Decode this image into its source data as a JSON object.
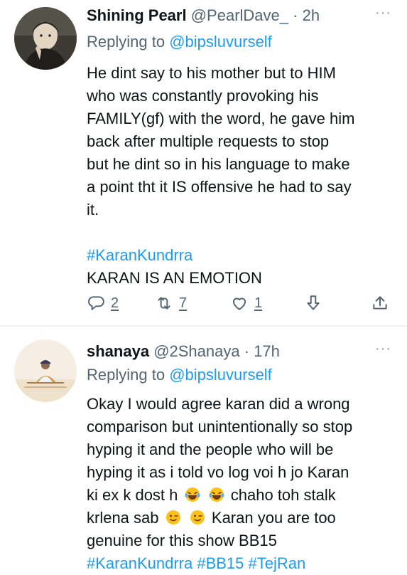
{
  "tweets": [
    {
      "name": "Shining Pearl",
      "handle": "@PearlDave_",
      "dot": "·",
      "time": "2h",
      "more": "···",
      "replying_prefix": "Replying to ",
      "replying_to": "@bipsluvurself",
      "body_lines": [
        "He dint say to his mother but to HIM",
        "who was constantly provoking his",
        "FAMILY(gf) with the word, he gave him",
        "back after multiple requests to stop",
        "but he dint so in his language to make",
        "a point tht it IS offensive he had to say",
        "it."
      ],
      "hashtag": "#KaranKundrra",
      "last_line": "KARAN IS AN EMOTION",
      "actions": {
        "reply_count": "2",
        "retweet_count": "7",
        "like_count": "1"
      },
      "avatar_icon": "user-avatar-icon"
    },
    {
      "name": "shanaya",
      "handle": "@2Shanaya",
      "dot": "·",
      "time": "17h",
      "more": "···",
      "replying_prefix": "Replying to ",
      "replying_to": "@bipsluvurself",
      "body_lines": [
        "Okay I would agree karan did a wrong",
        "comparison but unintentionally so stop",
        "hyping it and the people who will be",
        "hyping it as i told vo log voi h jo Karan"
      ],
      "line5_a": "ki ex k dost h",
      "line5_b": "chaho toh stalk",
      "line6_a": "krlena sab",
      "line6_b": "Karan you are too",
      "line7": "genuine for this show BB15",
      "hashtags": [
        "#KaranKundrra",
        "#BB15",
        "#TejRan"
      ],
      "avatar_icon": "user-avatar-icon"
    }
  ],
  "colors": {
    "link": "#1d9bf0",
    "secondary": "#536471",
    "text": "#0f1419",
    "divider": "#eff3f4"
  }
}
